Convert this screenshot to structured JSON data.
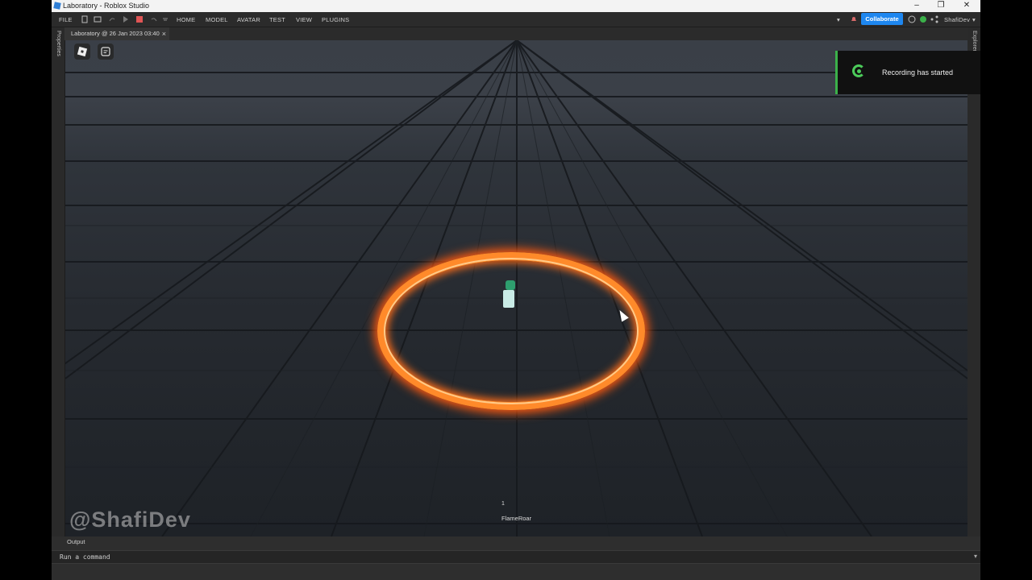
{
  "window": {
    "title": "Laboratory - Roblox Studio"
  },
  "menu": {
    "file": "FILE",
    "tabs": [
      "HOME",
      "MODEL",
      "AVATAR",
      "TEST",
      "VIEW",
      "PLUGINS"
    ],
    "collaborate": "Collaborate",
    "user": "ShafiDev"
  },
  "editor_tab": {
    "label": "Laboratory @ 26 Jan 2023 03:40",
    "close": "×"
  },
  "side_panels": {
    "left": "Properties",
    "right": "Explorer"
  },
  "viewport": {
    "watermark": "@ShafiDev",
    "hud_number": "1",
    "hud_ability": "FlameRoar"
  },
  "output": {
    "label": "Output",
    "command_placeholder": "Run a command"
  },
  "notification": {
    "text": "Recording has started",
    "accent": "#3bb14a"
  },
  "colors": {
    "accent": "#1e87f0",
    "ring": "#ff8a2a"
  }
}
